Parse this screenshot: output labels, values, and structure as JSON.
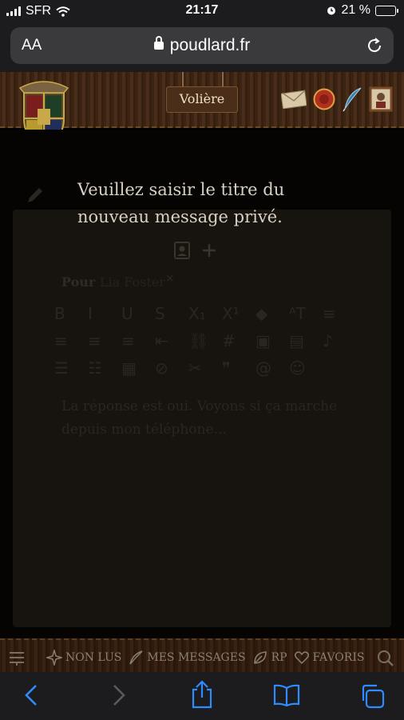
{
  "status": {
    "carrier": "SFR",
    "time": "21:17",
    "battery": "21 %"
  },
  "browser": {
    "aa_label": "AA",
    "url": "poudlard.fr"
  },
  "header": {
    "sign_label": "Volière"
  },
  "prompt": {
    "line1": "Veuillez saisir le titre du",
    "line2": "nouveau message privé."
  },
  "compose": {
    "recipient_label": "Pour",
    "recipient_name": "Lia Foster",
    "remove_mark": "×",
    "body_line1": "La réponse est oui. Voyons si ça marche",
    "body_line2": "depuis mon téléphone..."
  },
  "toolbar": {
    "row1": [
      "B",
      "I",
      "U",
      "S",
      "X₁",
      "X¹",
      "◆",
      "ᴬT",
      "≡"
    ],
    "row2": [
      "≡",
      "≡",
      "≡",
      "⇤",
      "⛓",
      "#",
      "▣",
      "▤",
      "♪"
    ],
    "row3": [
      "☰",
      "☷",
      "▦",
      "⊘",
      "✂",
      "❞",
      "@",
      "☺"
    ]
  },
  "forum_nav": {
    "unread": "NON LUS",
    "my_messages": "MES MESSAGES",
    "rp": "RP",
    "favorites": "FAVORIS"
  },
  "icons": {
    "wifi": "wifi-icon",
    "alarm": "alarm-icon",
    "charging": "bolt-icon"
  }
}
